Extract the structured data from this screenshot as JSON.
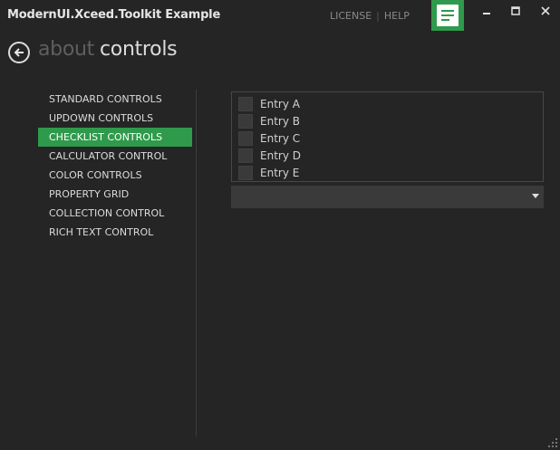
{
  "app": {
    "title": "ModernUI.Xceed.Toolkit Example",
    "accent_color": "#2f9a4c",
    "background_color": "#252525"
  },
  "toplinks": {
    "license": "LICENSE",
    "separator": "|",
    "help": "HELP"
  },
  "window_controls": {
    "menu_icon": "menu-lines-icon",
    "minimize_icon": "minimize-icon",
    "maximize_icon": "maximize-icon",
    "close_icon": "close-icon"
  },
  "breadcrumb": {
    "back_icon": "back-arrow-icon",
    "previous": "about",
    "current": "controls"
  },
  "sidebar": {
    "items": [
      {
        "label": "STANDARD CONTROLS",
        "active": false
      },
      {
        "label": "UPDOWN CONTROLS",
        "active": false
      },
      {
        "label": "CHECKLIST CONTROLS",
        "active": true
      },
      {
        "label": "CALCULATOR CONTROL",
        "active": false
      },
      {
        "label": "COLOR CONTROLS",
        "active": false
      },
      {
        "label": "PROPERTY GRID",
        "active": false
      },
      {
        "label": "COLLECTION CONTROL",
        "active": false
      },
      {
        "label": "RICH TEXT CONTROL",
        "active": false
      }
    ]
  },
  "checklist": {
    "entries": [
      {
        "label": "Entry A",
        "checked": false
      },
      {
        "label": "Entry B",
        "checked": false
      },
      {
        "label": "Entry C",
        "checked": false
      },
      {
        "label": "Entry D",
        "checked": false
      },
      {
        "label": "Entry E",
        "checked": false
      }
    ]
  },
  "combo": {
    "selected": "",
    "arrow_icon": "chevron-down-icon"
  }
}
